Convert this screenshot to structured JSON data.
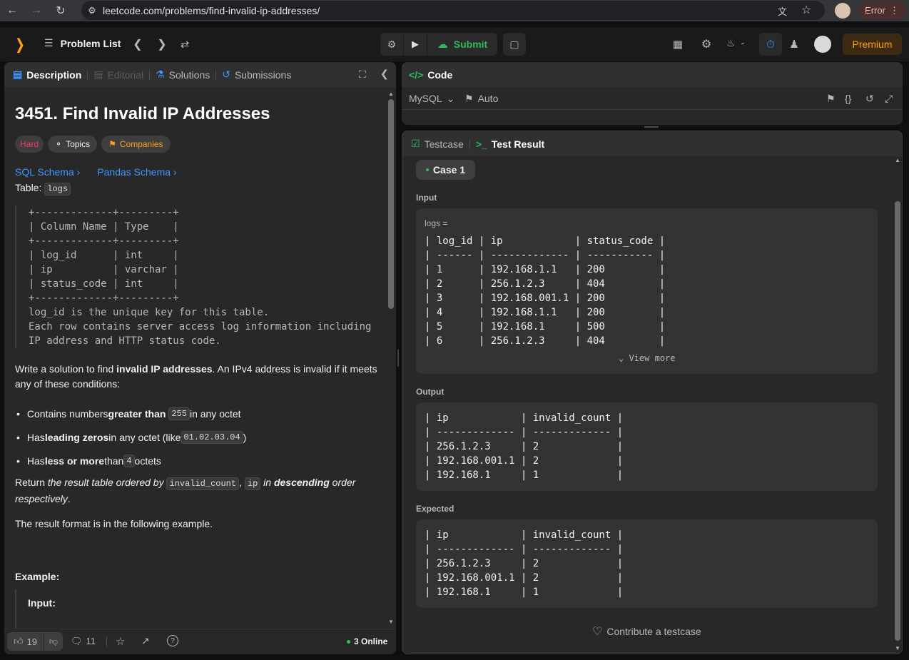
{
  "browser": {
    "url": "leetcode.com/problems/find-invalid-ip-addresses/",
    "error_label": "Error"
  },
  "navbar": {
    "problem_list": "Problem List",
    "submit": "Submit",
    "streak": "-",
    "premium": "Premium"
  },
  "left_tabs": {
    "description": "Description",
    "editorial": "Editorial",
    "solutions": "Solutions",
    "submissions": "Submissions"
  },
  "problem": {
    "title": "3451. Find Invalid IP Addresses",
    "difficulty": "Hard",
    "topics": "Topics",
    "companies": "Companies",
    "sql_schema": "SQL Schema",
    "pandas_schema": "Pandas Schema",
    "table_prefix": "Table:",
    "table_name": "logs",
    "schema_text": "+-------------+---------+\n| Column Name | Type    |\n+-------------+---------+\n| log_id      | int     |\n| ip          | varchar |\n| status_code | int     |\n+-------------+---------+\nlog_id is the unique key for this table.\nEach row contains server access log information including\nIP address and HTTP status code.",
    "desc_1": "Write a solution to find ",
    "desc_1b": "invalid IP addresses",
    "desc_1c": ". An IPv4 address is invalid if it meets any of these conditions:",
    "bullet_1a": "Contains numbers ",
    "bullet_1b": "greater than",
    "bullet_1c": "255",
    "bullet_1d": " in any octet",
    "bullet_2a": "Has ",
    "bullet_2b": "leading zeros",
    "bullet_2c": " in any octet (like ",
    "bullet_2d": "01.02.03.04",
    "bullet_2e": ")",
    "bullet_3a": "Has ",
    "bullet_3b": "less or more",
    "bullet_3c": " than ",
    "bullet_3d": "4",
    "bullet_3e": " octets",
    "return_a": "Return ",
    "return_b": "the result table ordered by ",
    "return_c": "invalid_count",
    "return_d": "ip",
    "return_e": " in ",
    "return_f": "descending",
    "return_g": " order respectively",
    "return_h": ".",
    "format_text": "The result format is in the following example.",
    "example_label": "Example:",
    "input_label": "Input:"
  },
  "footer": {
    "likes": "19",
    "comments": "11",
    "online": "3 Online"
  },
  "code_panel": {
    "title": "Code",
    "language": "MySQL",
    "auto": "Auto"
  },
  "result_panel": {
    "testcase_tab": "Testcase",
    "result_tab": "Test Result",
    "case_label": "Case 1",
    "input_label": "Input",
    "input_var": "logs =",
    "input_table": "| log_id | ip            | status_code |\n| ------ | ------------- | ----------- |\n| 1      | 192.168.1.1   | 200         |\n| 2      | 256.1.2.3     | 404         |\n| 3      | 192.168.001.1 | 200         |\n| 4      | 192.168.1.1   | 200         |\n| 5      | 192.168.1     | 500         |\n| 6      | 256.1.2.3     | 404         |",
    "view_more": "View more",
    "output_label": "Output",
    "output_table": "| ip            | invalid_count |\n| ------------- | ------------- |\n| 256.1.2.3     | 2             |\n| 192.168.001.1 | 2             |\n| 192.168.1     | 1             |",
    "expected_label": "Expected",
    "expected_table": "| ip            | invalid_count |\n| ------------- | ------------- |\n| 256.1.2.3     | 2             |\n| 192.168.001.1 | 2             |\n| 192.168.1     | 1             |",
    "contribute": "Contribute a testcase"
  },
  "colors": {
    "accent_green": "#2cbb5d",
    "hard_red": "#ff375f",
    "premium_orange": "#ffa116",
    "link_blue": "#3c97ff"
  }
}
